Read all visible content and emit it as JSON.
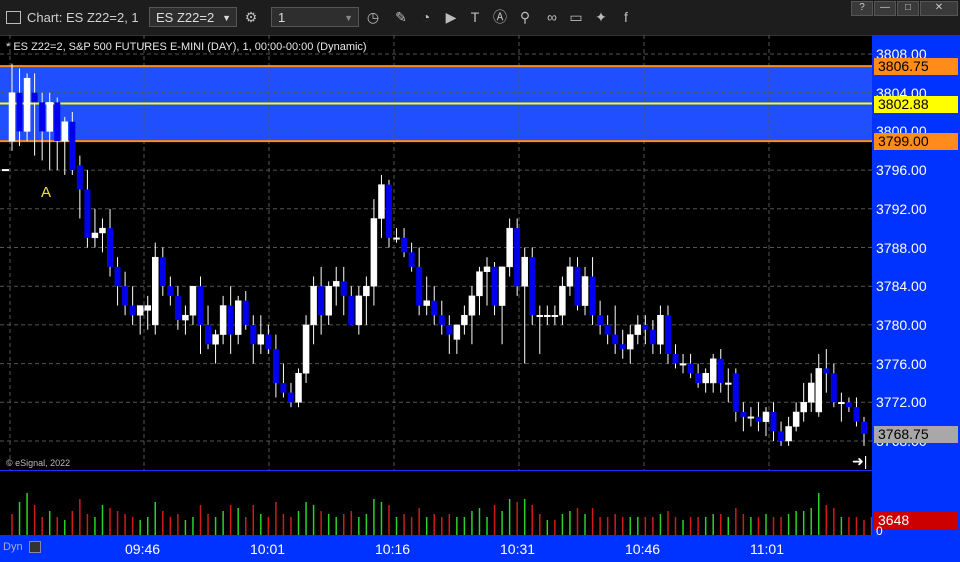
{
  "window": {
    "title": "Chart: ES Z22=2, 1"
  },
  "toolbar": {
    "symbol": "ES Z22=2",
    "interval": "1",
    "icons": [
      "gear-icon",
      "clock-icon",
      "pencil-icon",
      "draw-icon",
      "play-icon",
      "text-icon",
      "alert-icon",
      "link-icon",
      "comment-icon",
      "twitter-icon",
      "facebook-icon"
    ]
  },
  "window_buttons": [
    "?",
    "—",
    "□",
    "✕"
  ],
  "chart": {
    "study_label": "* ES Z22=2, S&P 500 FUTURES E-MINI (DAY), 1, 00:00-00:00 (Dynamic)",
    "copyright": "© eSignal, 2022",
    "annotation": "A",
    "dyn_label": "Dyn",
    "volume_tag": "3648",
    "volume_zero": "0"
  },
  "colors": {
    "background": "#000000",
    "axis": "#0033ff",
    "zone": "#1f4fff",
    "up_candle": "#ffffff",
    "down_candle": "#0000ee",
    "yellow_line": "#ffff00",
    "orange_line": "#ff8c1a",
    "last_tag": "#a8a8a8",
    "volume_up": "#2bd12b",
    "volume_down": "#d11b1b",
    "volume_tag_bg": "#cc0000"
  },
  "chart_data": {
    "type": "candlestick",
    "y_ticks": [
      "3808.00",
      "3804.00",
      "3800.00",
      "3796.00",
      "3792.00",
      "3788.00",
      "3784.00",
      "3780.00",
      "3776.00",
      "3772.00",
      "3768.00"
    ],
    "x_ticks": [
      "09:46",
      "10:01",
      "10:16",
      "10:31",
      "10:46",
      "11:01"
    ],
    "ylim": [
      3767,
      3809
    ],
    "grid": true,
    "levels": [
      {
        "label": "3806.75",
        "value": 3806.75,
        "color": "#ff8c1a",
        "text": "#000000"
      },
      {
        "label": "3802.88",
        "value": 3802.88,
        "color": "#ffff00",
        "text": "#000000"
      },
      {
        "label": "3799.00",
        "value": 3799.0,
        "color": "#ff8c1a",
        "text": "#000000"
      }
    ],
    "zone": [
      3799.0,
      3806.75
    ],
    "last_price": "3768.75",
    "candles": [
      {
        "o": 3799.0,
        "h": 3807.0,
        "l": 3798.0,
        "c": 3804.0
      },
      {
        "o": 3804.0,
        "h": 3806.5,
        "l": 3798.5,
        "c": 3800.0
      },
      {
        "o": 3800.0,
        "h": 3806.0,
        "l": 3799.0,
        "c": 3805.5
      },
      {
        "o": 3804.0,
        "h": 3806.0,
        "l": 3797.5,
        "c": 3803.0
      },
      {
        "o": 3803.0,
        "h": 3804.0,
        "l": 3797.0,
        "c": 3800.0
      },
      {
        "o": 3800.0,
        "h": 3804.0,
        "l": 3796.0,
        "c": 3803.0
      },
      {
        "o": 3803.0,
        "h": 3803.5,
        "l": 3796.0,
        "c": 3799.0
      },
      {
        "o": 3799.0,
        "h": 3801.5,
        "l": 3795.5,
        "c": 3801.0
      },
      {
        "o": 3801.0,
        "h": 3802.0,
        "l": 3795.5,
        "c": 3796.0
      },
      {
        "o": 3796.5,
        "h": 3797.5,
        "l": 3791.0,
        "c": 3794.0
      },
      {
        "o": 3794.0,
        "h": 3796.0,
        "l": 3788.0,
        "c": 3789.0
      },
      {
        "o": 3789.0,
        "h": 3792.0,
        "l": 3788.0,
        "c": 3789.5
      },
      {
        "o": 3789.5,
        "h": 3791.0,
        "l": 3787.5,
        "c": 3790.0
      },
      {
        "o": 3790.0,
        "h": 3792.0,
        "l": 3785.0,
        "c": 3786.0
      },
      {
        "o": 3786.0,
        "h": 3787.0,
        "l": 3782.0,
        "c": 3784.0
      },
      {
        "o": 3784.0,
        "h": 3785.5,
        "l": 3781.0,
        "c": 3782.0
      },
      {
        "o": 3782.0,
        "h": 3784.0,
        "l": 3780.0,
        "c": 3781.0
      },
      {
        "o": 3781.0,
        "h": 3782.0,
        "l": 3779.0,
        "c": 3782.0
      },
      {
        "o": 3781.5,
        "h": 3783.0,
        "l": 3779.5,
        "c": 3782.0
      },
      {
        "o": 3780.0,
        "h": 3788.5,
        "l": 3779.0,
        "c": 3787.0
      },
      {
        "o": 3787.0,
        "h": 3788.0,
        "l": 3783.0,
        "c": 3784.0
      },
      {
        "o": 3784.0,
        "h": 3785.0,
        "l": 3782.0,
        "c": 3783.0
      },
      {
        "o": 3783.0,
        "h": 3784.0,
        "l": 3779.5,
        "c": 3780.5
      },
      {
        "o": 3780.5,
        "h": 3782.0,
        "l": 3779.0,
        "c": 3781.0
      },
      {
        "o": 3781.0,
        "h": 3784.0,
        "l": 3780.0,
        "c": 3784.0
      },
      {
        "o": 3784.0,
        "h": 3785.0,
        "l": 3777.0,
        "c": 3780.0
      },
      {
        "o": 3780.0,
        "h": 3782.0,
        "l": 3777.5,
        "c": 3778.0
      },
      {
        "o": 3778.0,
        "h": 3779.5,
        "l": 3776.0,
        "c": 3779.0
      },
      {
        "o": 3779.0,
        "h": 3783.0,
        "l": 3778.0,
        "c": 3782.0
      },
      {
        "o": 3782.0,
        "h": 3784.0,
        "l": 3777.0,
        "c": 3779.0
      },
      {
        "o": 3779.0,
        "h": 3783.0,
        "l": 3778.0,
        "c": 3782.5
      },
      {
        "o": 3782.5,
        "h": 3783.5,
        "l": 3779.5,
        "c": 3780.0
      },
      {
        "o": 3780.0,
        "h": 3781.0,
        "l": 3776.0,
        "c": 3778.0
      },
      {
        "o": 3778.0,
        "h": 3781.0,
        "l": 3777.0,
        "c": 3779.0
      },
      {
        "o": 3779.0,
        "h": 3780.0,
        "l": 3777.0,
        "c": 3777.5
      },
      {
        "o": 3777.5,
        "h": 3779.0,
        "l": 3772.5,
        "c": 3774.0
      },
      {
        "o": 3774.0,
        "h": 3776.0,
        "l": 3772.5,
        "c": 3773.0
      },
      {
        "o": 3773.0,
        "h": 3774.0,
        "l": 3771.5,
        "c": 3772.0
      },
      {
        "o": 3772.0,
        "h": 3775.5,
        "l": 3771.5,
        "c": 3775.0
      },
      {
        "o": 3775.0,
        "h": 3781.0,
        "l": 3774.0,
        "c": 3780.0
      },
      {
        "o": 3780.0,
        "h": 3785.0,
        "l": 3778.0,
        "c": 3784.0
      },
      {
        "o": 3784.0,
        "h": 3786.0,
        "l": 3779.0,
        "c": 3781.0
      },
      {
        "o": 3781.0,
        "h": 3784.5,
        "l": 3780.0,
        "c": 3784.0
      },
      {
        "o": 3784.0,
        "h": 3786.0,
        "l": 3782.0,
        "c": 3784.5
      },
      {
        "o": 3784.5,
        "h": 3786.0,
        "l": 3781.0,
        "c": 3783.0
      },
      {
        "o": 3783.0,
        "h": 3784.0,
        "l": 3780.0,
        "c": 3780.0
      },
      {
        "o": 3780.0,
        "h": 3784.0,
        "l": 3779.0,
        "c": 3783.0
      },
      {
        "o": 3783.0,
        "h": 3785.0,
        "l": 3780.0,
        "c": 3784.0
      },
      {
        "o": 3784.0,
        "h": 3793.0,
        "l": 3782.0,
        "c": 3791.0
      },
      {
        "o": 3791.0,
        "h": 3795.5,
        "l": 3789.0,
        "c": 3794.5
      },
      {
        "o": 3794.5,
        "h": 3795.0,
        "l": 3788.0,
        "c": 3789.0
      },
      {
        "o": 3789.0,
        "h": 3790.0,
        "l": 3788.5,
        "c": 3789.0
      },
      {
        "o": 3789.0,
        "h": 3790.0,
        "l": 3787.0,
        "c": 3787.5
      },
      {
        "o": 3787.5,
        "h": 3788.5,
        "l": 3785.5,
        "c": 3786.0
      },
      {
        "o": 3786.0,
        "h": 3788.0,
        "l": 3781.0,
        "c": 3782.0
      },
      {
        "o": 3782.0,
        "h": 3785.0,
        "l": 3781.0,
        "c": 3782.5
      },
      {
        "o": 3782.5,
        "h": 3784.0,
        "l": 3780.0,
        "c": 3781.0
      },
      {
        "o": 3781.0,
        "h": 3782.5,
        "l": 3779.0,
        "c": 3780.0
      },
      {
        "o": 3780.0,
        "h": 3781.0,
        "l": 3777.0,
        "c": 3779.0
      },
      {
        "o": 3778.5,
        "h": 3780.0,
        "l": 3777.0,
        "c": 3780.0
      },
      {
        "o": 3780.0,
        "h": 3782.0,
        "l": 3779.0,
        "c": 3781.0
      },
      {
        "o": 3781.0,
        "h": 3784.0,
        "l": 3778.0,
        "c": 3783.0
      },
      {
        "o": 3783.0,
        "h": 3786.0,
        "l": 3781.0,
        "c": 3785.5
      },
      {
        "o": 3785.5,
        "h": 3787.0,
        "l": 3782.0,
        "c": 3786.0
      },
      {
        "o": 3786.0,
        "h": 3786.5,
        "l": 3781.0,
        "c": 3782.0
      },
      {
        "o": 3782.0,
        "h": 3783.0,
        "l": 3778.0,
        "c": 3786.0
      },
      {
        "o": 3786.0,
        "h": 3791.0,
        "l": 3785.0,
        "c": 3790.0
      },
      {
        "o": 3790.0,
        "h": 3791.0,
        "l": 3783.0,
        "c": 3784.0
      },
      {
        "o": 3784.0,
        "h": 3788.0,
        "l": 3776.0,
        "c": 3787.0
      },
      {
        "o": 3787.0,
        "h": 3788.0,
        "l": 3780.0,
        "c": 3781.0
      },
      {
        "o": 3781.0,
        "h": 3782.0,
        "l": 3777.0,
        "c": 3781.0
      },
      {
        "o": 3781.0,
        "h": 3782.0,
        "l": 3780.0,
        "c": 3781.0
      },
      {
        "o": 3781.0,
        "h": 3782.0,
        "l": 3780.0,
        "c": 3781.0
      },
      {
        "o": 3781.0,
        "h": 3785.0,
        "l": 3780.0,
        "c": 3784.0
      },
      {
        "o": 3784.0,
        "h": 3787.0,
        "l": 3783.0,
        "c": 3786.0
      },
      {
        "o": 3786.0,
        "h": 3787.0,
        "l": 3781.5,
        "c": 3782.0
      },
      {
        "o": 3782.0,
        "h": 3786.0,
        "l": 3781.0,
        "c": 3785.0
      },
      {
        "o": 3785.0,
        "h": 3787.0,
        "l": 3780.0,
        "c": 3781.0
      },
      {
        "o": 3781.0,
        "h": 3782.5,
        "l": 3779.0,
        "c": 3780.0
      },
      {
        "o": 3780.0,
        "h": 3781.0,
        "l": 3778.0,
        "c": 3779.0
      },
      {
        "o": 3779.0,
        "h": 3782.0,
        "l": 3777.0,
        "c": 3778.0
      },
      {
        "o": 3778.0,
        "h": 3779.5,
        "l": 3776.5,
        "c": 3777.5
      },
      {
        "o": 3777.5,
        "h": 3780.0,
        "l": 3776.0,
        "c": 3779.0
      },
      {
        "o": 3779.0,
        "h": 3781.0,
        "l": 3778.0,
        "c": 3780.0
      },
      {
        "o": 3780.0,
        "h": 3781.0,
        "l": 3778.0,
        "c": 3779.5
      },
      {
        "o": 3779.5,
        "h": 3780.5,
        "l": 3777.0,
        "c": 3778.0
      },
      {
        "o": 3778.0,
        "h": 3782.0,
        "l": 3777.0,
        "c": 3781.0
      },
      {
        "o": 3781.0,
        "h": 3782.0,
        "l": 3776.0,
        "c": 3777.0
      },
      {
        "o": 3777.0,
        "h": 3778.0,
        "l": 3775.5,
        "c": 3776.0
      },
      {
        "o": 3776.0,
        "h": 3777.0,
        "l": 3775.0,
        "c": 3776.0
      },
      {
        "o": 3776.0,
        "h": 3777.0,
        "l": 3774.5,
        "c": 3775.0
      },
      {
        "o": 3775.0,
        "h": 3776.0,
        "l": 3773.5,
        "c": 3774.0
      },
      {
        "o": 3774.0,
        "h": 3775.5,
        "l": 3773.0,
        "c": 3775.0
      },
      {
        "o": 3774.0,
        "h": 3777.0,
        "l": 3773.0,
        "c": 3776.5
      },
      {
        "o": 3776.5,
        "h": 3777.5,
        "l": 3773.0,
        "c": 3774.0
      },
      {
        "o": 3774.0,
        "h": 3775.5,
        "l": 3772.0,
        "c": 3774.0
      },
      {
        "o": 3775.0,
        "h": 3775.5,
        "l": 3770.0,
        "c": 3771.0
      },
      {
        "o": 3771.0,
        "h": 3772.0,
        "l": 3769.0,
        "c": 3770.5
      },
      {
        "o": 3770.5,
        "h": 3771.5,
        "l": 3769.5,
        "c": 3770.5
      },
      {
        "o": 3770.5,
        "h": 3772.0,
        "l": 3769.0,
        "c": 3770.0
      },
      {
        "o": 3770.0,
        "h": 3771.5,
        "l": 3768.5,
        "c": 3771.0
      },
      {
        "o": 3771.0,
        "h": 3772.0,
        "l": 3768.0,
        "c": 3769.0
      },
      {
        "o": 3769.0,
        "h": 3770.0,
        "l": 3767.5,
        "c": 3768.0
      },
      {
        "o": 3768.0,
        "h": 3770.5,
        "l": 3767.5,
        "c": 3769.5
      },
      {
        "o": 3769.5,
        "h": 3772.0,
        "l": 3769.0,
        "c": 3771.0
      },
      {
        "o": 3771.0,
        "h": 3774.0,
        "l": 3770.0,
        "c": 3772.0
      },
      {
        "o": 3772.0,
        "h": 3775.0,
        "l": 3771.0,
        "c": 3774.0
      },
      {
        "o": 3771.0,
        "h": 3777.0,
        "l": 3770.5,
        "c": 3775.5
      },
      {
        "o": 3775.5,
        "h": 3777.5,
        "l": 3773.0,
        "c": 3775.0
      },
      {
        "o": 3775.0,
        "h": 3776.0,
        "l": 3771.5,
        "c": 3772.0
      },
      {
        "o": 3772.0,
        "h": 3773.0,
        "l": 3770.0,
        "c": 3772.0
      },
      {
        "o": 3772.0,
        "h": 3772.5,
        "l": 3771.0,
        "c": 3771.5
      },
      {
        "o": 3771.5,
        "h": 3772.5,
        "l": 3769.5,
        "c": 3770.0
      },
      {
        "o": 3770.0,
        "h": 3770.5,
        "l": 3767.5,
        "c": 3768.75
      }
    ],
    "volume": [
      {
        "v": 0.35,
        "up": false
      },
      {
        "v": 0.55,
        "up": true
      },
      {
        "v": 0.7,
        "up": true
      },
      {
        "v": 0.5,
        "up": false
      },
      {
        "v": 0.3,
        "up": false
      },
      {
        "v": 0.4,
        "up": true
      },
      {
        "v": 0.3,
        "up": false
      },
      {
        "v": 0.25,
        "up": true
      },
      {
        "v": 0.4,
        "up": false
      },
      {
        "v": 0.6,
        "up": false
      },
      {
        "v": 0.35,
        "up": false
      },
      {
        "v": 0.3,
        "up": true
      },
      {
        "v": 0.5,
        "up": true
      },
      {
        "v": 0.45,
        "up": false
      },
      {
        "v": 0.4,
        "up": false
      },
      {
        "v": 0.35,
        "up": false
      },
      {
        "v": 0.3,
        "up": false
      },
      {
        "v": 0.25,
        "up": true
      },
      {
        "v": 0.3,
        "up": true
      },
      {
        "v": 0.55,
        "up": true
      },
      {
        "v": 0.4,
        "up": false
      },
      {
        "v": 0.3,
        "up": false
      },
      {
        "v": 0.35,
        "up": false
      },
      {
        "v": 0.25,
        "up": true
      },
      {
        "v": 0.3,
        "up": true
      },
      {
        "v": 0.5,
        "up": false
      },
      {
        "v": 0.35,
        "up": false
      },
      {
        "v": 0.3,
        "up": true
      },
      {
        "v": 0.4,
        "up": true
      },
      {
        "v": 0.5,
        "up": false
      },
      {
        "v": 0.45,
        "up": true
      },
      {
        "v": 0.3,
        "up": false
      },
      {
        "v": 0.5,
        "up": false
      },
      {
        "v": 0.35,
        "up": true
      },
      {
        "v": 0.3,
        "up": false
      },
      {
        "v": 0.55,
        "up": false
      },
      {
        "v": 0.35,
        "up": false
      },
      {
        "v": 0.3,
        "up": false
      },
      {
        "v": 0.4,
        "up": true
      },
      {
        "v": 0.55,
        "up": true
      },
      {
        "v": 0.5,
        "up": true
      },
      {
        "v": 0.4,
        "up": false
      },
      {
        "v": 0.35,
        "up": true
      },
      {
        "v": 0.3,
        "up": true
      },
      {
        "v": 0.35,
        "up": false
      },
      {
        "v": 0.4,
        "up": false
      },
      {
        "v": 0.3,
        "up": true
      },
      {
        "v": 0.35,
        "up": true
      },
      {
        "v": 0.6,
        "up": true
      },
      {
        "v": 0.55,
        "up": true
      },
      {
        "v": 0.5,
        "up": false
      },
      {
        "v": 0.3,
        "up": true
      },
      {
        "v": 0.35,
        "up": false
      },
      {
        "v": 0.3,
        "up": false
      },
      {
        "v": 0.45,
        "up": false
      },
      {
        "v": 0.3,
        "up": true
      },
      {
        "v": 0.35,
        "up": false
      },
      {
        "v": 0.3,
        "up": false
      },
      {
        "v": 0.35,
        "up": false
      },
      {
        "v": 0.3,
        "up": true
      },
      {
        "v": 0.3,
        "up": true
      },
      {
        "v": 0.4,
        "up": true
      },
      {
        "v": 0.45,
        "up": true
      },
      {
        "v": 0.3,
        "up": true
      },
      {
        "v": 0.5,
        "up": false
      },
      {
        "v": 0.4,
        "up": true
      },
      {
        "v": 0.6,
        "up": true
      },
      {
        "v": 0.55,
        "up": false
      },
      {
        "v": 0.6,
        "up": true
      },
      {
        "v": 0.5,
        "up": false
      },
      {
        "v": 0.35,
        "up": false
      },
      {
        "v": 0.25,
        "up": true
      },
      {
        "v": 0.25,
        "up": false
      },
      {
        "v": 0.35,
        "up": true
      },
      {
        "v": 0.4,
        "up": true
      },
      {
        "v": 0.45,
        "up": false
      },
      {
        "v": 0.35,
        "up": true
      },
      {
        "v": 0.45,
        "up": false
      },
      {
        "v": 0.3,
        "up": false
      },
      {
        "v": 0.3,
        "up": false
      },
      {
        "v": 0.35,
        "up": false
      },
      {
        "v": 0.3,
        "up": false
      },
      {
        "v": 0.3,
        "up": true
      },
      {
        "v": 0.3,
        "up": true
      },
      {
        "v": 0.3,
        "up": false
      },
      {
        "v": 0.3,
        "up": false
      },
      {
        "v": 0.35,
        "up": true
      },
      {
        "v": 0.4,
        "up": false
      },
      {
        "v": 0.3,
        "up": false
      },
      {
        "v": 0.25,
        "up": true
      },
      {
        "v": 0.3,
        "up": false
      },
      {
        "v": 0.3,
        "up": false
      },
      {
        "v": 0.3,
        "up": true
      },
      {
        "v": 0.35,
        "up": true
      },
      {
        "v": 0.35,
        "up": false
      },
      {
        "v": 0.3,
        "up": true
      },
      {
        "v": 0.45,
        "up": false
      },
      {
        "v": 0.35,
        "up": false
      },
      {
        "v": 0.3,
        "up": true
      },
      {
        "v": 0.3,
        "up": false
      },
      {
        "v": 0.35,
        "up": true
      },
      {
        "v": 0.3,
        "up": false
      },
      {
        "v": 0.3,
        "up": false
      },
      {
        "v": 0.35,
        "up": true
      },
      {
        "v": 0.4,
        "up": true
      },
      {
        "v": 0.4,
        "up": true
      },
      {
        "v": 0.45,
        "up": true
      },
      {
        "v": 0.7,
        "up": true
      },
      {
        "v": 0.5,
        "up": false
      },
      {
        "v": 0.45,
        "up": false
      },
      {
        "v": 0.3,
        "up": true
      },
      {
        "v": 0.3,
        "up": false
      },
      {
        "v": 0.3,
        "up": false
      },
      {
        "v": 0.25,
        "up": false
      },
      {
        "v": 0.3,
        "up": false
      }
    ]
  }
}
